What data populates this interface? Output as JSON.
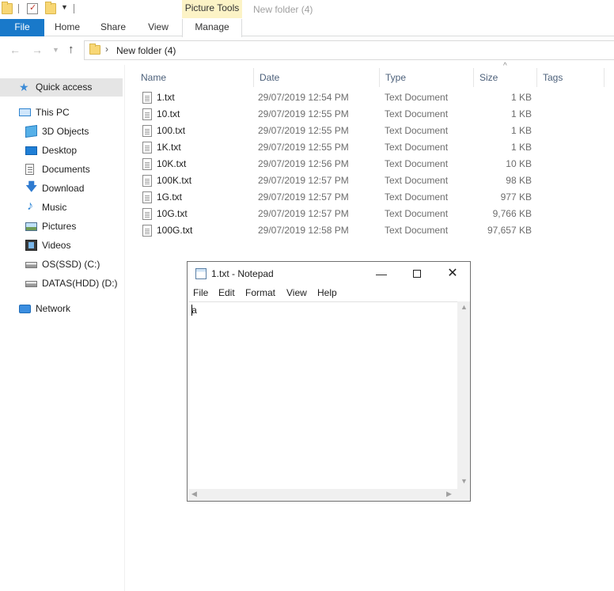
{
  "titlebar": {
    "context_tab": "Picture Tools",
    "window_title": "New folder (4)"
  },
  "ribbon": {
    "tabs": [
      "File",
      "Home",
      "Share",
      "View",
      "Manage"
    ]
  },
  "address": {
    "path": "New folder (4)"
  },
  "navpane": {
    "quick_access": "Quick access",
    "this_pc": "This PC",
    "items": [
      "3D Objects",
      "Desktop",
      "Documents",
      "Download",
      "Music",
      "Pictures",
      "Videos",
      "OS(SSD) (C:)",
      "DATAS(HDD) (D:)"
    ],
    "network": "Network"
  },
  "filelist": {
    "columns": [
      "Name",
      "Date",
      "Type",
      "Size",
      "Tags"
    ],
    "rows": [
      {
        "name": "1.txt",
        "date": "29/07/2019 12:54 PM",
        "type": "Text Document",
        "size": "1 KB"
      },
      {
        "name": "10.txt",
        "date": "29/07/2019 12:55 PM",
        "type": "Text Document",
        "size": "1 KB"
      },
      {
        "name": "100.txt",
        "date": "29/07/2019 12:55 PM",
        "type": "Text Document",
        "size": "1 KB"
      },
      {
        "name": "1K.txt",
        "date": "29/07/2019 12:55 PM",
        "type": "Text Document",
        "size": "1 KB"
      },
      {
        "name": "10K.txt",
        "date": "29/07/2019 12:56 PM",
        "type": "Text Document",
        "size": "10 KB"
      },
      {
        "name": "100K.txt",
        "date": "29/07/2019 12:57 PM",
        "type": "Text Document",
        "size": "98 KB"
      },
      {
        "name": "1G.txt",
        "date": "29/07/2019 12:57 PM",
        "type": "Text Document",
        "size": "977 KB"
      },
      {
        "name": "10G.txt",
        "date": "29/07/2019 12:57 PM",
        "type": "Text Document",
        "size": "9,766 KB"
      },
      {
        "name": "100G.txt",
        "date": "29/07/2019 12:58 PM",
        "type": "Text Document",
        "size": "97,657 KB"
      }
    ]
  },
  "notepad": {
    "title": "1.txt - Notepad",
    "menu": [
      "File",
      "Edit",
      "Format",
      "View",
      "Help"
    ],
    "content": "a"
  }
}
